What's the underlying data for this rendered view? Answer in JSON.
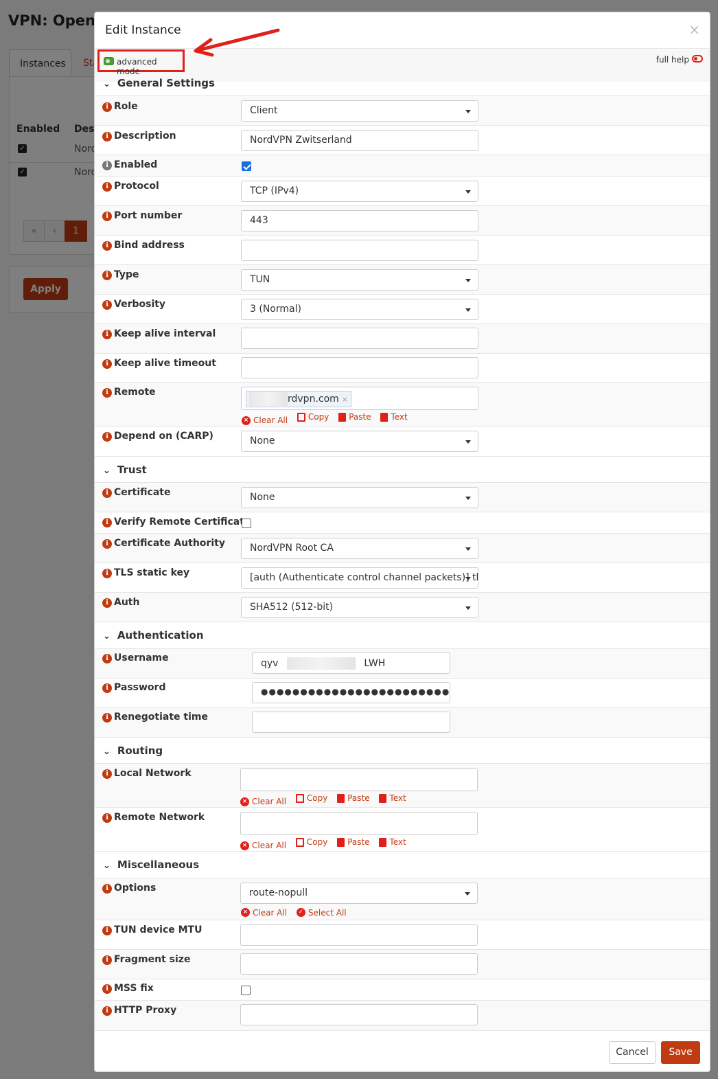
{
  "background": {
    "page_title": "VPN: OpenV",
    "tabs": [
      "Instances",
      "Sta"
    ],
    "table_headers": [
      "Enabled",
      "Desc"
    ],
    "rows": [
      {
        "desc": "Nord"
      },
      {
        "desc": "Nord"
      }
    ],
    "pager": [
      "«",
      "‹",
      "1"
    ],
    "apply_label": "Apply"
  },
  "modal": {
    "title": "Edit Instance",
    "close": "×",
    "advanced_mode_label": "advanced mode",
    "full_help_label": "full help",
    "cancel_label": "Cancel",
    "save_label": "Save"
  },
  "token_actions": {
    "clear_all": "Clear All",
    "copy": "Copy",
    "paste": "Paste",
    "text": "Text",
    "select_all": "Select All"
  },
  "sections": {
    "general": "General Settings",
    "trust": "Trust",
    "authentication": "Authentication",
    "routing": "Routing",
    "misc": "Miscellaneous"
  },
  "fields": {
    "role": {
      "label": "Role",
      "value": "Client"
    },
    "description": {
      "label": "Description",
      "value": "NordVPN Zwitserland"
    },
    "enabled": {
      "label": "Enabled",
      "checked": true
    },
    "protocol": {
      "label": "Protocol",
      "value": "TCP (IPv4)"
    },
    "port": {
      "label": "Port number",
      "value": "443"
    },
    "bind": {
      "label": "Bind address",
      "value": ""
    },
    "type": {
      "label": "Type",
      "value": "TUN"
    },
    "verbosity": {
      "label": "Verbosity",
      "value": "3 (Normal)"
    },
    "keepalive_interval": {
      "label": "Keep alive interval",
      "value": ""
    },
    "keepalive_timeout": {
      "label": "Keep alive timeout",
      "value": ""
    },
    "remote": {
      "label": "Remote",
      "tag": "rdvpn.com"
    },
    "depend": {
      "label": "Depend on (CARP)",
      "value": "None"
    },
    "certificate": {
      "label": "Certificate",
      "value": "None"
    },
    "verify_remote": {
      "label": "Verify Remote Certificate",
      "checked": false
    },
    "ca": {
      "label": "Certificate Authority",
      "value": "NordVPN Root CA"
    },
    "tls_key": {
      "label": "TLS static key",
      "value": "[auth (Authenticate control channel packets)] tls-a"
    },
    "auth": {
      "label": "Auth",
      "value": "SHA512 (512-bit)"
    },
    "username": {
      "label": "Username",
      "value_start": "qyv",
      "value_end": "LWH"
    },
    "password": {
      "label": "Password",
      "value": "●●●●●●●●●●●●●●●●●●●●●●●●"
    },
    "renegotiate": {
      "label": "Renegotiate time",
      "value": ""
    },
    "local_network": {
      "label": "Local Network"
    },
    "remote_network": {
      "label": "Remote Network"
    },
    "options": {
      "label": "Options",
      "value": "route-nopull"
    },
    "tun_mtu": {
      "label": "TUN device MTU",
      "value": ""
    },
    "fragment": {
      "label": "Fragment size",
      "value": ""
    },
    "mss_fix": {
      "label": "MSS fix",
      "checked": false
    },
    "http_proxy": {
      "label": "HTTP Proxy",
      "value": ""
    }
  },
  "colors": {
    "accent": "#c03b12",
    "highlight": "#e0201a",
    "toggle_on": "#4a9d34"
  }
}
